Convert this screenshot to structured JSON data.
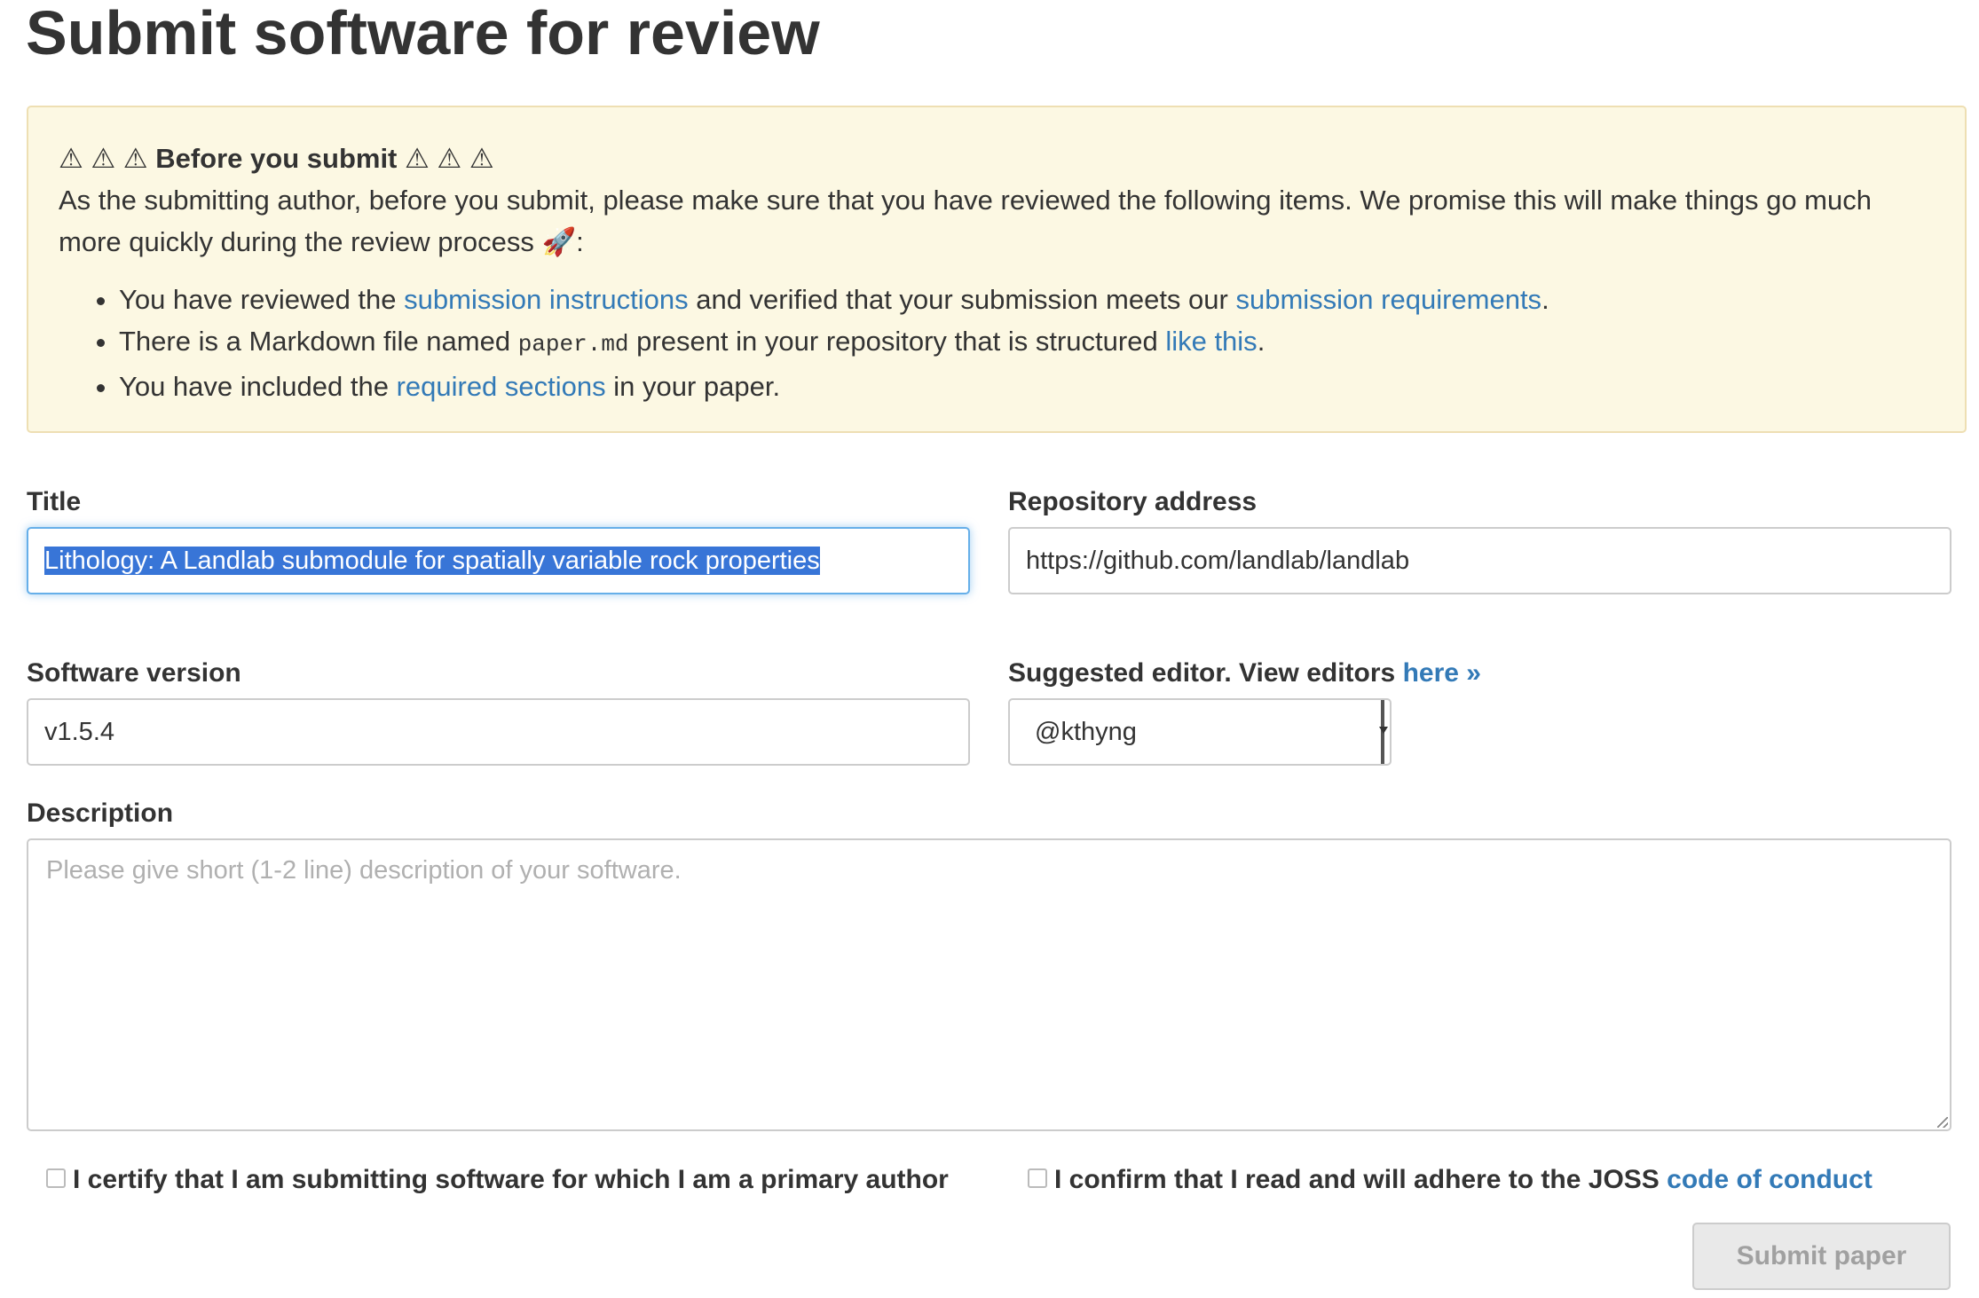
{
  "page": {
    "title": "Submit software for review"
  },
  "notice": {
    "warning_icons_left": "⚠ ⚠ ⚠",
    "heading": "Before you submit",
    "warning_icons_right": "⚠ ⚠ ⚠",
    "intro": "As the submitting author, before you submit, please make sure that you have reviewed the following items. We promise this will make things go much more quickly during the review process",
    "rocket_icon": "🚀",
    "intro_end": ":",
    "items": [
      {
        "prefix": "You have reviewed the ",
        "link1": "submission instructions",
        "middle": " and verified that your submission meets our ",
        "link2": "submission requirements",
        "suffix": "."
      },
      {
        "prefix": "There is a Markdown file named ",
        "code": "paper.md",
        "middle": " present in your repository that is structured ",
        "link1": "like this",
        "suffix": "."
      },
      {
        "prefix": "You have included the ",
        "link1": "required sections",
        "suffix": " in your paper."
      }
    ]
  },
  "form": {
    "title_label": "Title",
    "title_value": "Lithology: A Landlab submodule for spatially variable rock properties",
    "repo_label": "Repository address",
    "repo_value": "https://github.com/landlab/landlab",
    "version_label": "Software version",
    "version_value": "v1.5.4",
    "editor_label": "Suggested editor. View editors ",
    "editor_link": "here »",
    "editor_value": "@kthyng",
    "description_label": "Description",
    "description_placeholder": "Please give short (1-2 line) description of your software.",
    "certify_label": "I certify that I am submitting software for which I am a primary author",
    "conduct_label": "I confirm that I read and will adhere to the JOSS ",
    "conduct_link": "code of conduct",
    "submit_label": "Submit paper"
  },
  "colors": {
    "link": "#337ab7",
    "notice_bg": "#fcf8e3",
    "notice_border": "#eedfb3",
    "focus_border": "#66afe9",
    "selection": "#3875d7"
  }
}
